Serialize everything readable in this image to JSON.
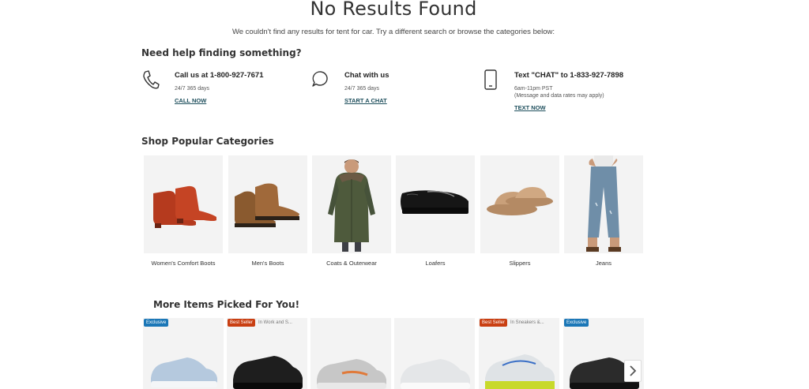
{
  "page": {
    "title": "No Results Found",
    "subtitle": "We couldn't find any results for tent for car. Try a different search or browse the categories below:"
  },
  "help": {
    "heading": "Need help finding something?",
    "items": [
      {
        "title": "Call us at 1-800-927-7671",
        "sub": "24/7 365 days",
        "link": "CALL NOW",
        "icon": "phone-icon"
      },
      {
        "title": "Chat with us",
        "sub": "24/7 365 days",
        "link": "START A CHAT",
        "icon": "chat-bubble-icon"
      },
      {
        "title": "Text \"CHAT\" to 1-833-927-7898",
        "sub": "6am-11pm PST",
        "sub2": "(Message and data rates may apply)",
        "link": "TEXT NOW",
        "icon": "mobile-phone-icon"
      }
    ]
  },
  "categories": {
    "heading": "Shop Popular Categories",
    "items": [
      {
        "label": "Women's Comfort Boots",
        "image": "red-ankle-boots"
      },
      {
        "label": "Men's Boots",
        "image": "brown-lace-up-boots"
      },
      {
        "label": "Coats & Outerwear",
        "image": "green-parka-man"
      },
      {
        "label": "Loafers",
        "image": "black-patent-loafer"
      },
      {
        "label": "Slippers",
        "image": "tan-shearling-slides"
      },
      {
        "label": "Jeans",
        "image": "cropped-blue-jeans"
      }
    ]
  },
  "more": {
    "heading": "More Items Picked For You!",
    "products": [
      {
        "badge": "Exclusive",
        "badge_type": "exclusive",
        "badge_cat": "",
        "image": "light-blue-sneaker"
      },
      {
        "badge": "Best Seller",
        "badge_type": "bestseller",
        "badge_cat": "In Work and S...",
        "image": "black-work-sneaker"
      },
      {
        "badge": "",
        "badge_type": "",
        "badge_cat": "",
        "image": "grey-running-shoe"
      },
      {
        "badge": "",
        "badge_type": "",
        "badge_cat": "",
        "image": "white-sneaker"
      },
      {
        "badge": "Best Seller",
        "badge_type": "bestseller",
        "badge_cat": "In Sneakers &...",
        "image": "white-volt-running-shoe"
      },
      {
        "badge": "Exclusive",
        "badge_type": "exclusive",
        "badge_cat": "",
        "image": "black-running-shoe"
      }
    ],
    "next_icon": "chevron-right-icon"
  },
  "colors": {
    "link": "#1d4e5c",
    "exclusive_badge": "#1b77b7",
    "bestseller_badge": "#c93f12",
    "tile_bg": "#f3f3f3"
  }
}
